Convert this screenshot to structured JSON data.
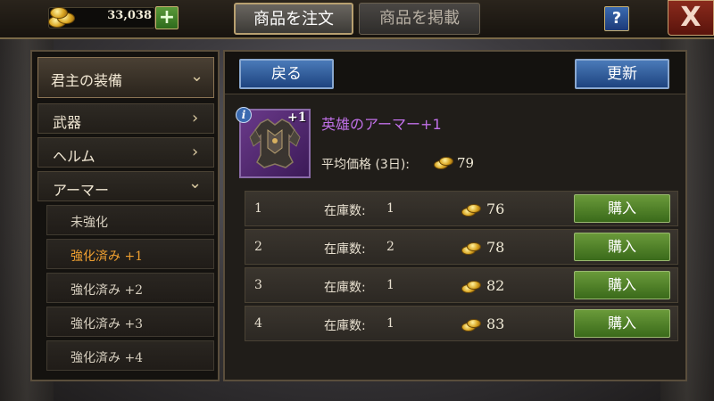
{
  "header": {
    "gold_amount": "33,038",
    "plus_label": "+",
    "tabs": [
      {
        "label": "商品を注文",
        "active": true
      },
      {
        "label": "商品を掲載",
        "active": false
      }
    ],
    "help_label": "?",
    "close_label": "X"
  },
  "sidebar": {
    "category_label": "君主の装備",
    "items": [
      {
        "label": "武器",
        "chevron": "right"
      },
      {
        "label": "ヘルム",
        "chevron": "right"
      },
      {
        "label": "アーマー",
        "chevron": "down"
      }
    ],
    "sub_items": [
      {
        "label": "未強化",
        "active": false
      },
      {
        "label": "強化済み +1",
        "active": true
      },
      {
        "label": "強化済み +2",
        "active": false
      },
      {
        "label": "強化済み +3",
        "active": false
      },
      {
        "label": "強化済み +4",
        "active": false
      }
    ]
  },
  "main": {
    "back_label": "戻る",
    "refresh_label": "更新",
    "item": {
      "info_label": "i",
      "plus_tag": "+1",
      "name": "英雄のアーマー+1",
      "avg_label": "平均価格 (3日):",
      "avg_price": "79"
    },
    "listings": [
      {
        "num": "1",
        "stock_label": "在庫数:",
        "stock": "1",
        "price": "76",
        "buy_label": "購入"
      },
      {
        "num": "2",
        "stock_label": "在庫数:",
        "stock": "2",
        "price": "78",
        "buy_label": "購入"
      },
      {
        "num": "3",
        "stock_label": "在庫数:",
        "stock": "1",
        "price": "82",
        "buy_label": "購入"
      },
      {
        "num": "4",
        "stock_label": "在庫数:",
        "stock": "1",
        "price": "83",
        "buy_label": "購入"
      }
    ]
  },
  "colors": {
    "item_name": "#c070e8",
    "active_sub_item": "#f0a030",
    "buy_button": "#4a7a2a",
    "blue_button": "#2e5a98"
  }
}
